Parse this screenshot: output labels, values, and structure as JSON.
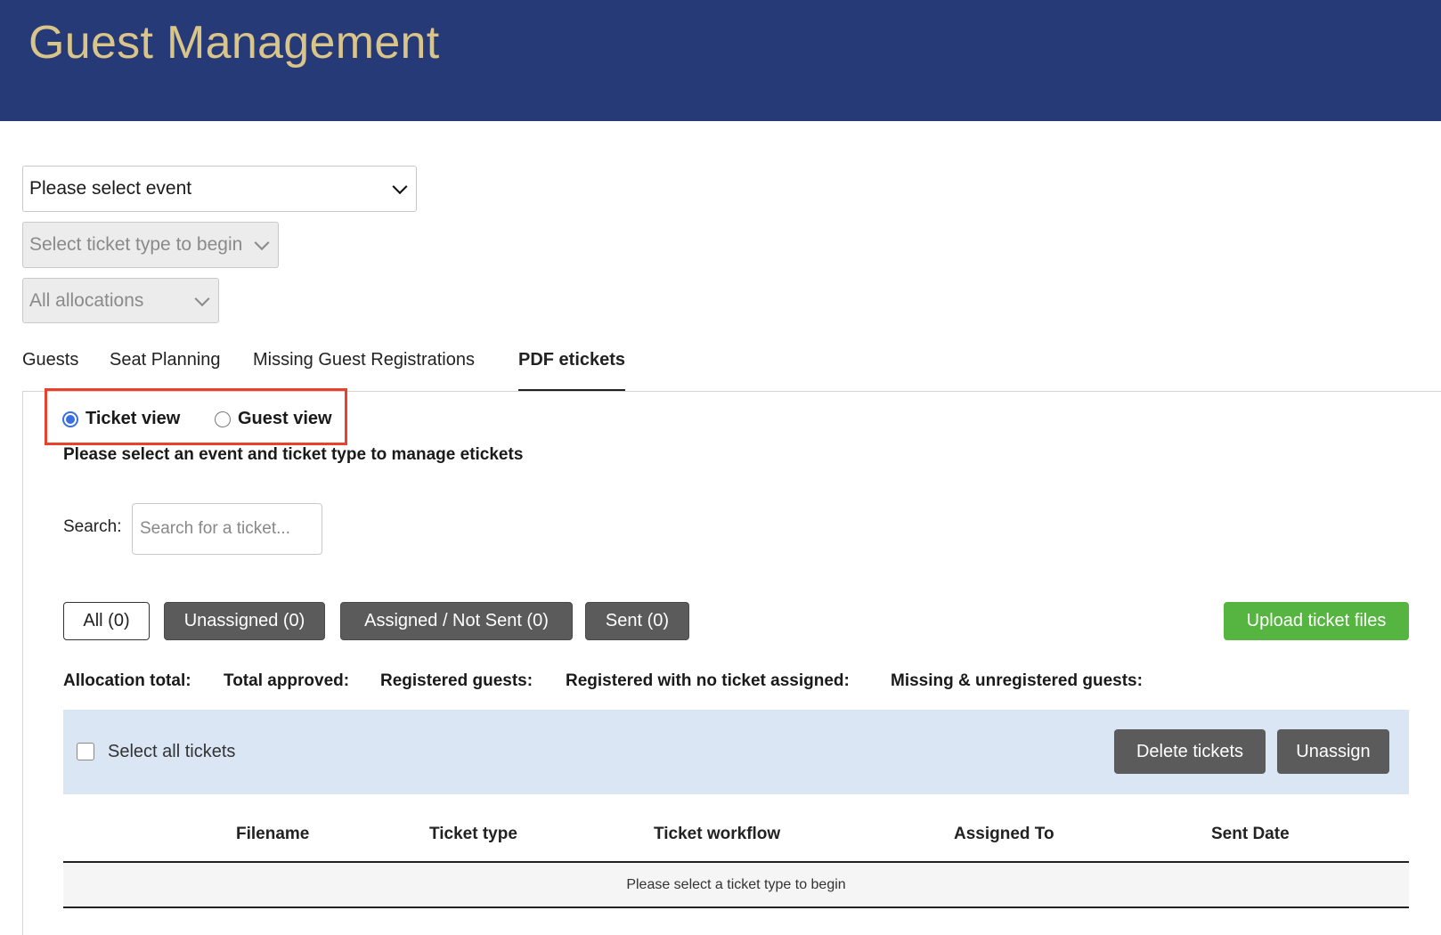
{
  "header": {
    "title": "Guest Management"
  },
  "filters": {
    "event_select": "Please select event",
    "ticket_type_select": "Select ticket type to begin",
    "allocations_select": "All allocations"
  },
  "tabs": [
    {
      "label": "Guests",
      "active": false
    },
    {
      "label": "Seat Planning",
      "active": false
    },
    {
      "label": "Missing Guest Registrations",
      "active": false
    },
    {
      "label": "PDF etickets",
      "active": true
    }
  ],
  "view_toggle": {
    "ticket_view": "Ticket view",
    "guest_view": "Guest view",
    "selected": "ticket_view"
  },
  "instruction": "Please select an event and ticket type to manage etickets",
  "search": {
    "label": "Search:",
    "placeholder": "Search for a ticket..."
  },
  "status_filters": [
    {
      "label": "All (0)"
    },
    {
      "label": "Unassigned (0)"
    },
    {
      "label": "Assigned / Not Sent (0)"
    },
    {
      "label": "Sent (0)"
    }
  ],
  "upload_button": "Upload ticket files",
  "stats": {
    "allocation_total": "Allocation total:",
    "total_approved": "Total approved:",
    "registered_guests": "Registered guests:",
    "registered_no_ticket": "Registered with no ticket assigned:",
    "missing_unregistered": "Missing & unregistered guests:"
  },
  "action_bar": {
    "select_all": "Select all tickets",
    "delete_button": "Delete tickets",
    "unassign_button": "Unassign"
  },
  "table": {
    "columns": [
      "Filename",
      "Ticket type",
      "Ticket workflow",
      "Assigned To",
      "Sent Date"
    ],
    "empty_message": "Please select a ticket type to begin"
  },
  "colors": {
    "header_bg": "#263a78",
    "title_gold": "#d9c48a",
    "upload_green": "#56b540",
    "highlight_red": "#e8412c",
    "action_bar_bg": "#dbe6f5"
  }
}
